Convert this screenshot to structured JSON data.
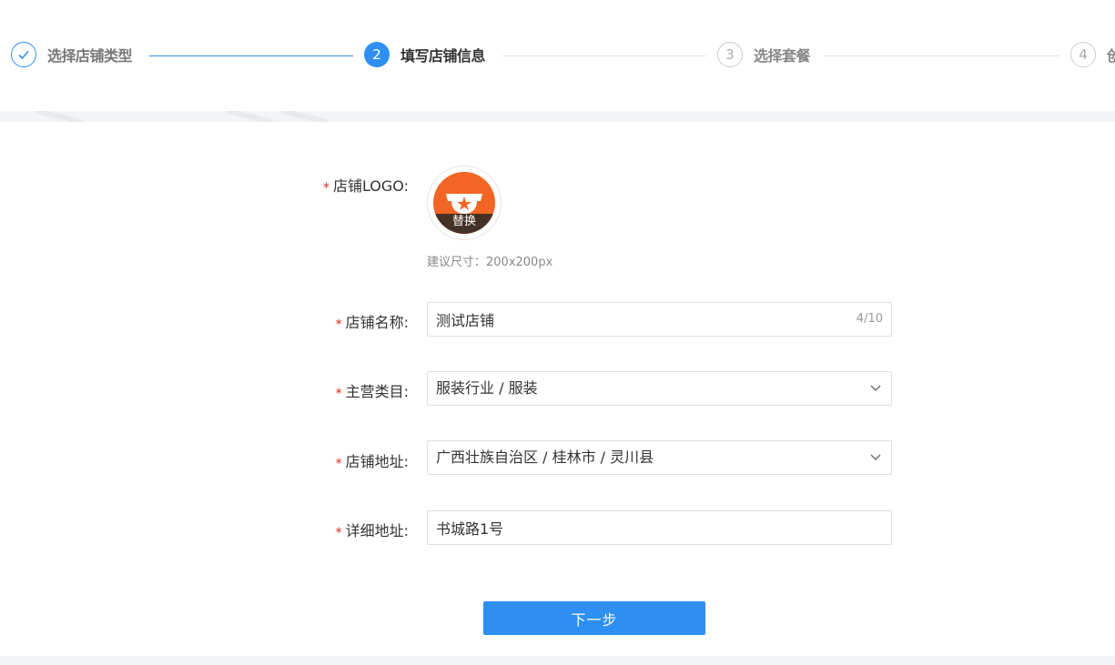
{
  "colors": {
    "primary": "#2e8ff0",
    "required": "#e2231a",
    "logo_bg": "#f26522"
  },
  "steps": [
    {
      "number": "✓",
      "title": "选择店铺类型",
      "status": "done",
      "icon": "check-icon"
    },
    {
      "number": "2",
      "title": "填写店铺信息",
      "status": "active"
    },
    {
      "number": "3",
      "title": "选择套餐",
      "status": "wait"
    },
    {
      "number": "4",
      "title": "创",
      "status": "wait"
    }
  ],
  "form": {
    "required_mark": "*",
    "logo": {
      "label": "店铺LOGO:",
      "replace_label": "替换",
      "hint": "建议尺寸：200x200px",
      "icon": "trophy-star-icon"
    },
    "shop_name": {
      "label": "店铺名称:",
      "value": "测试店铺",
      "counter": "4/10"
    },
    "category": {
      "label": "主营类目:",
      "value": "服装行业 / 服装",
      "icon": "chevron-down-icon"
    },
    "address": {
      "label": "店铺地址:",
      "value": "广西壮族自治区 / 桂林市 / 灵川县",
      "icon": "chevron-down-icon"
    },
    "detail_address": {
      "label": "详细地址:",
      "value": "书城路1号"
    }
  },
  "actions": {
    "next_label": "下一步"
  }
}
